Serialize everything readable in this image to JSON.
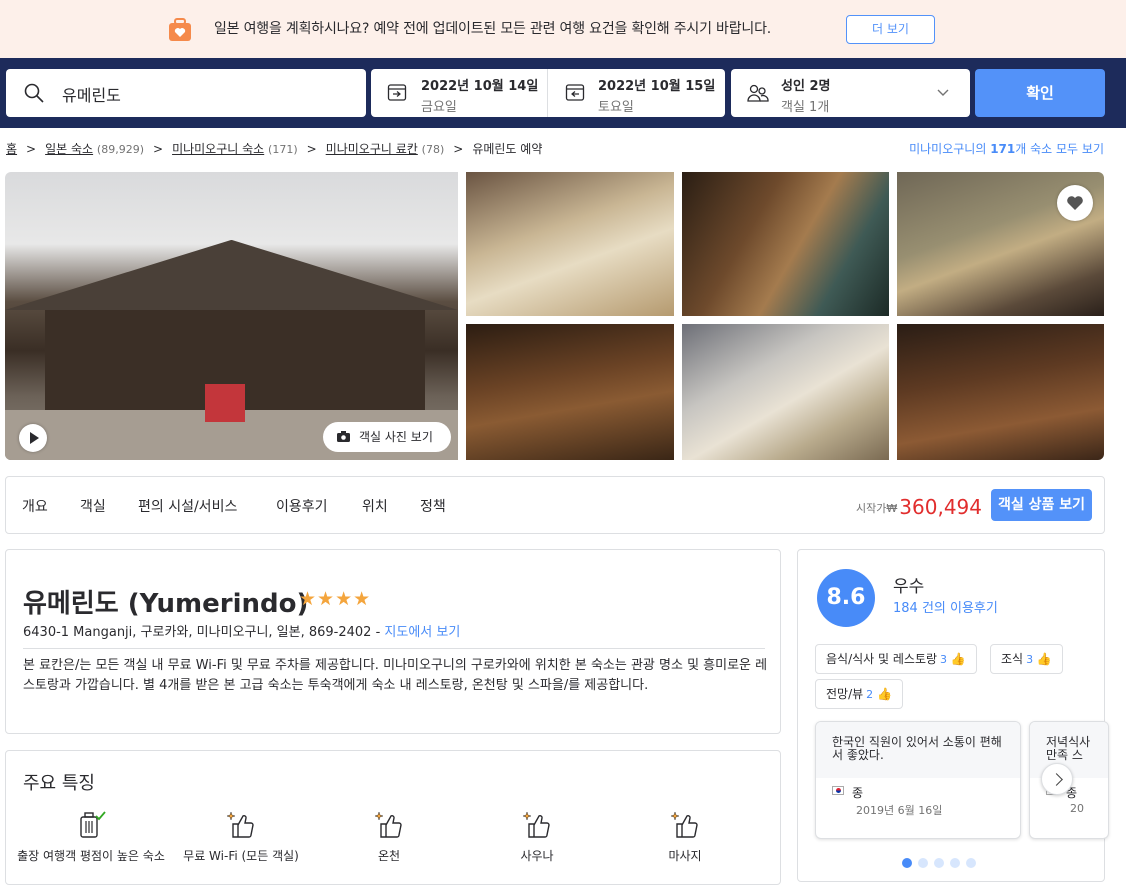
{
  "banner": {
    "message": "일본 여행을 계획하시나요? 예약 전에 업데이트된 모든 관련 여행 요건을 확인해 주시기 바랍니다.",
    "more_label": "더 보기"
  },
  "search": {
    "destination": "유메린도",
    "checkin_date": "2022년 10월 14일",
    "checkin_day": "금요일",
    "checkout_date": "2022년 10월 15일",
    "checkout_day": "토요일",
    "guests": "성인 2명",
    "rooms": "객실 1개",
    "confirm_label": "확인"
  },
  "breadcrumb": {
    "home": "홈",
    "items": [
      {
        "label": "일본 숙소",
        "count": "(89,929)"
      },
      {
        "label": "미나미오구니 숙소",
        "count": "(171)"
      },
      {
        "label": "미나미오구니 료칸",
        "count": "(78)"
      }
    ],
    "current": "유메린도 예약",
    "all_prefix": "미나미오구니의 ",
    "all_count": "171",
    "all_suffix": "개 숙소 모두 보기"
  },
  "gallery": {
    "room_photos_label": "객실 사진 보기"
  },
  "tabs": [
    "개요",
    "객실",
    "편의 시설/서비스",
    "이용후기",
    "위치",
    "정책"
  ],
  "price": {
    "from_label": "시작가",
    "currency": "₩",
    "amount": "360,494",
    "rooms_button": "객실 상품 보기"
  },
  "hotel": {
    "name": "유메린도 (Yumerindo)",
    "stars": "★★★★",
    "address": "6430-1 Manganji, 구로카와, 미나미오구니, 일본, 869-2402 - ",
    "map_link": "지도에서 보기",
    "description": "본 료칸은/는 모든 객실 내 무료 Wi-Fi 및 무료 주차를 제공합니다. 미나미오구니의 구로카와에 위치한 본 숙소는 관광 명소 및 흥미로운 레스토랑과 가깝습니다. 별 4개를 받은 본 고급 숙소는 투숙객에게 숙소 내 레스토랑, 온천탕 및 스파을/를 제공합니다."
  },
  "features": {
    "title": "주요 특징",
    "items": [
      {
        "label": "출장 여행객 평점이 높은 숙소",
        "icon": "luggage-check-icon"
      },
      {
        "label": "무료 Wi-Fi (모든 객실)",
        "icon": "thumbs-up-sparkle-icon"
      },
      {
        "label": "온천",
        "icon": "thumbs-up-sparkle-icon"
      },
      {
        "label": "사우나",
        "icon": "thumbs-up-sparkle-icon"
      },
      {
        "label": "마사지",
        "icon": "thumbs-up-sparkle-icon"
      }
    ]
  },
  "review": {
    "score": "8.6",
    "label": "우수",
    "count": "184 건의 이용후기",
    "chips": [
      {
        "label": "음식/식사 및 레스토랑",
        "n": "3"
      },
      {
        "label": "조식",
        "n": "3"
      },
      {
        "label": "전망/뷰",
        "n": "2"
      }
    ],
    "cards": [
      {
        "quote": "한국인 직원이 있어서 소통이 편해서 좋았다.",
        "name": "종",
        "date": "2019년 6월 16일"
      },
      {
        "quote": "저녁식사 만족 스",
        "name": "종",
        "date": "20"
      }
    ]
  },
  "colors": {
    "accent": "#5392f9",
    "header_bg": "#1d2b5b",
    "price": "#e12d2d",
    "banner_bg": "#fdf0ea"
  }
}
